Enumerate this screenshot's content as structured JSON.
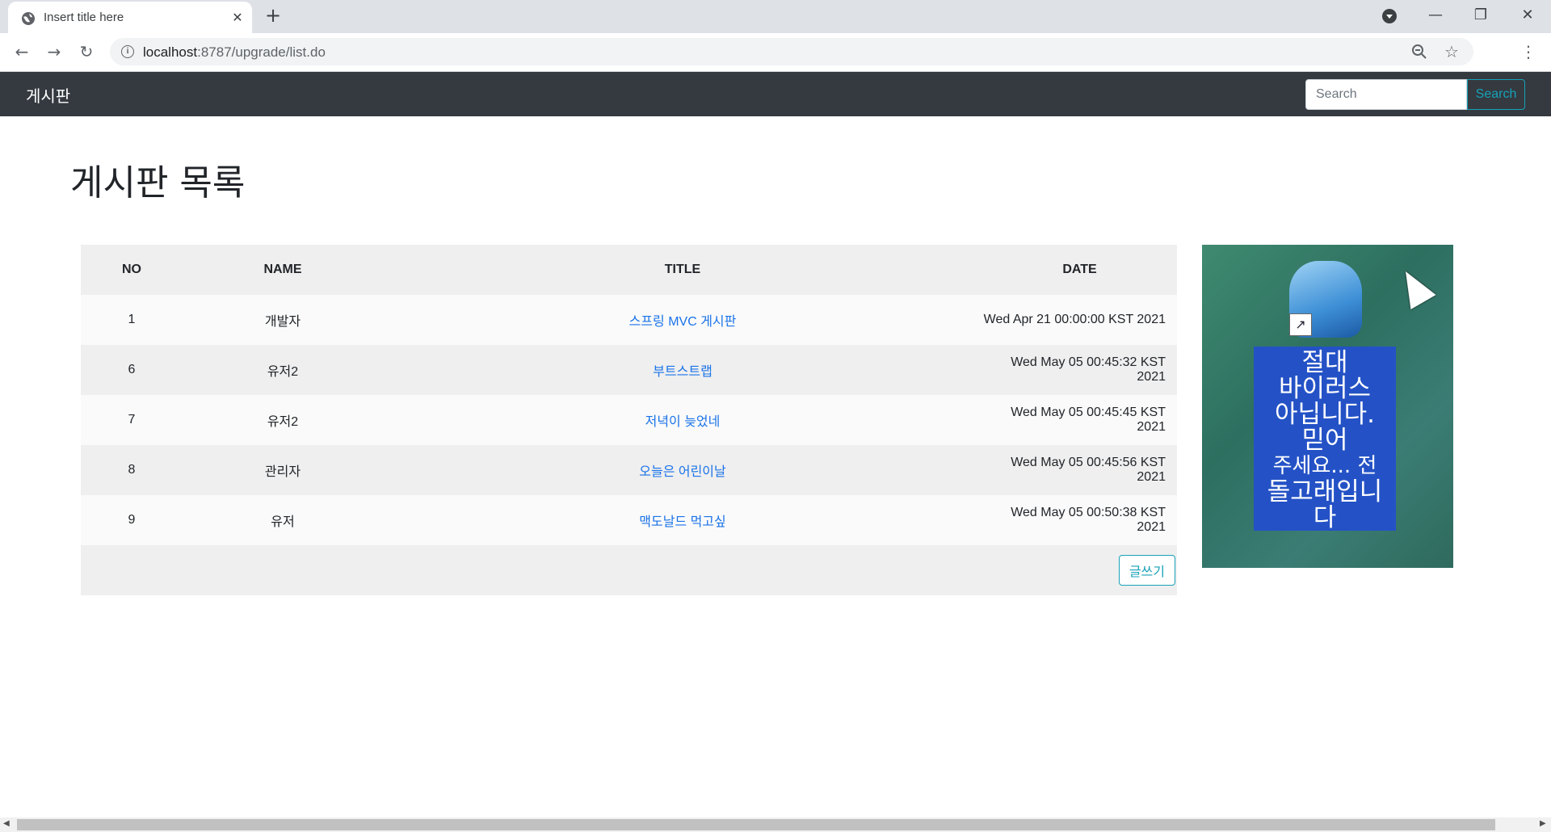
{
  "browser": {
    "tab_title": "Insert title here",
    "url_host": "localhost",
    "url_path": ":8787/upgrade/list.do"
  },
  "navbar": {
    "brand": "게시판",
    "search_placeholder": "Search",
    "search_button": "Search"
  },
  "page": {
    "title": "게시판 목록"
  },
  "table": {
    "headers": [
      "NO",
      "NAME",
      "TITLE",
      "DATE"
    ],
    "rows": [
      {
        "no": "1",
        "name": "개발자",
        "title": "스프링 MVC 게시판",
        "date": "Wed Apr 21 00:00:00 KST 2021"
      },
      {
        "no": "6",
        "name": "유저2",
        "title": "부트스트랩",
        "date": "Wed May 05 00:45:32 KST 2021"
      },
      {
        "no": "7",
        "name": "유저2",
        "title": "저녁이 늦었네",
        "date": "Wed May 05 00:45:45 KST 2021"
      },
      {
        "no": "8",
        "name": "관리자",
        "title": "오늘은 어린이날",
        "date": "Wed May 05 00:45:56 KST 2021"
      },
      {
        "no": "9",
        "name": "유저",
        "title": "맥도날드 먹고싶",
        "date": "Wed May 05 00:50:38 KST 2021"
      }
    ],
    "write_button": "글쓰기"
  },
  "side_image": {
    "caption_lines": [
      "절대",
      "바이러스",
      "아닙니다.",
      "믿어",
      "주세요... 전",
      "돌고래입니",
      "다"
    ]
  },
  "icons": {
    "favicon": "globe-icon",
    "back": "back-arrow-icon",
    "forward": "forward-arrow-icon",
    "reload": "reload-icon",
    "info": "info-icon",
    "zoom": "zoom-icon",
    "bookmark": "star-icon",
    "menu": "kebab-menu-icon"
  },
  "colors": {
    "navbar": "#343a40",
    "accent": "#17a2b8",
    "link": "#1a73e8"
  }
}
